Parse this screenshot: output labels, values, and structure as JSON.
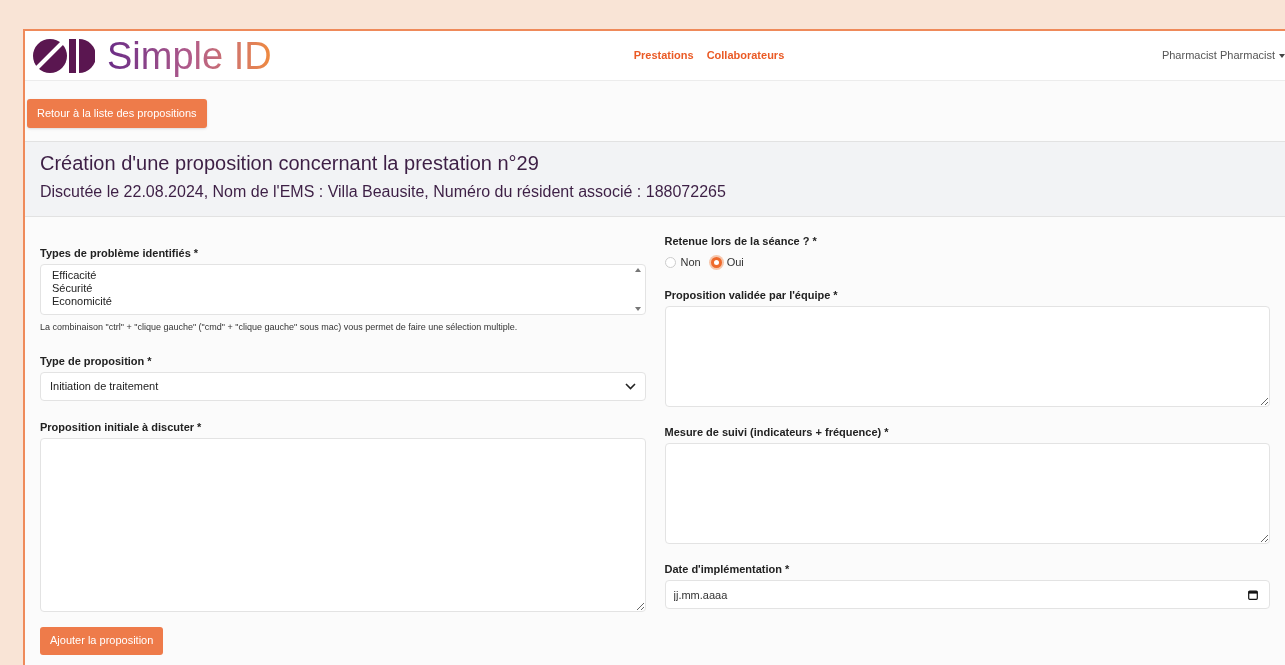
{
  "navbar": {
    "brand": "Simple ID",
    "links": [
      {
        "label": "Prestations"
      },
      {
        "label": "Collaborateurs"
      }
    ],
    "user": "Pharmacist Pharmacist"
  },
  "back_button": "Retour à la liste des propositions",
  "header": {
    "title": "Création d'une proposition concernant la prestation n°29",
    "subtitle": "Discutée le 22.08.2024, Nom de l'EMS : Villa Beausite, Numéro du résident associé : 188072265"
  },
  "left_fields": [
    {
      "kind": "multiselect",
      "label": "Types de problème identifiés *",
      "options": [
        {
          "label": "Efficacité",
          "selected": false
        },
        {
          "label": "Sécurité",
          "selected": false
        },
        {
          "label": "Economicité",
          "selected": false
        }
      ],
      "help": "La combinaison \"ctrl\" + \"clique gauche\" (\"cmd\" + \"clique gauche\" sous mac) vous permet de faire une sélection multiple."
    },
    {
      "kind": "select",
      "label": "Type de proposition *",
      "value": "Initiation de traitement"
    },
    {
      "kind": "textarea",
      "label": "Proposition initiale à discuter *"
    }
  ],
  "right_fields": [
    {
      "kind": "radio",
      "label": "Retenue lors de la séance ? *",
      "options": [
        {
          "label": "Non",
          "selected": false
        },
        {
          "label": "Oui",
          "selected": true
        }
      ]
    },
    {
      "kind": "textarea",
      "label": "Proposition validée par l'équipe *"
    },
    {
      "kind": "textarea",
      "label": "Mesure de suivi (indicateurs + fréquence) *"
    },
    {
      "kind": "date",
      "label": "Date d'implémentation *",
      "placeholder": "jj.mm.aaaa"
    }
  ],
  "submit_button": "Ajouter la proposition"
}
